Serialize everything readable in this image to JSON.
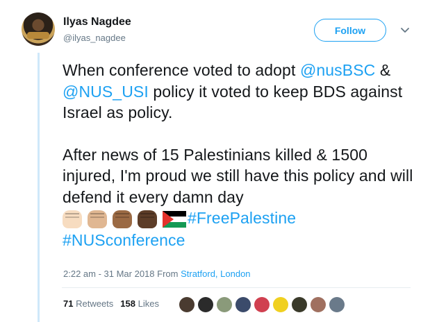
{
  "user": {
    "name": "Ilyas Nagdee",
    "handle": "@ilyas_nagdee",
    "follow_label": "Follow"
  },
  "tweet": {
    "p1_pre": "When conference voted to adopt ",
    "mention1": "@nusBSC",
    "p1_mid": " & ",
    "mention2": "@NUS_USI",
    "p1_post": " policy it voted to keep BDS against Israel as policy.",
    "p2": "After news of 15 Palestinians killed & 1500 injured, I'm proud we still have this policy and will defend it every damn day",
    "hashtag1": "#FreePalestine",
    "hashtag2": "#NUSconference",
    "emoji": [
      "raised-fist-light-skin",
      "raised-fist-medium-light-skin",
      "raised-fist-medium-dark-skin",
      "raised-fist-dark-skin",
      "palestine-flag"
    ]
  },
  "meta": {
    "time": "2:22 am - 31 Mar 2018 From ",
    "location": "Stratford, London"
  },
  "stats": {
    "retweets_count": "71",
    "retweets_label": "Retweets",
    "likes_count": "158",
    "likes_label": "Likes"
  },
  "colors": {
    "accent": "#1da1f2",
    "thread_line": "#cfe8fa",
    "fist_tones": [
      "#f7dcc0",
      "#e0b792",
      "#9b6a44",
      "#5d3d28"
    ],
    "liker_avatars": [
      "#4a3b30",
      "#2b2b2b",
      "#8a9a7a",
      "#3b4b6b",
      "#d04050",
      "#f0d020",
      "#3a3a2a",
      "#a07060",
      "#6a7a8a"
    ]
  }
}
